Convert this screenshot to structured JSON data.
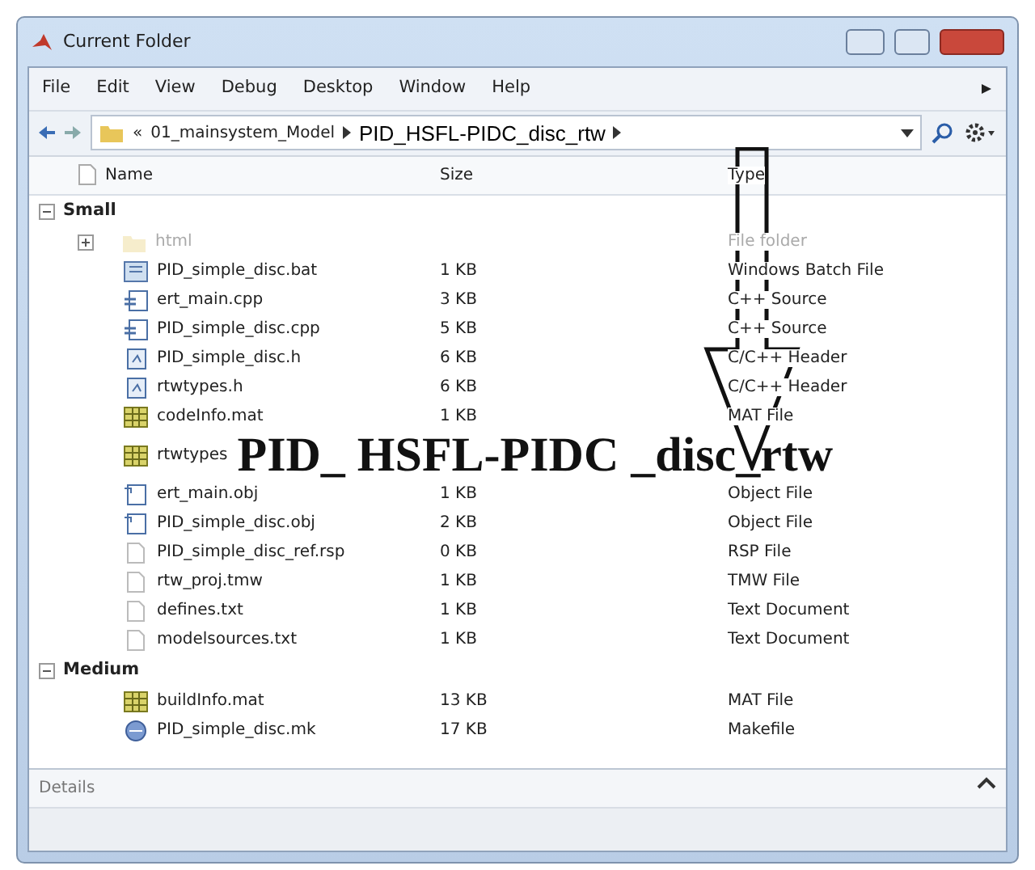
{
  "window": {
    "title": "Current Folder"
  },
  "menu": [
    "File",
    "Edit",
    "View",
    "Debug",
    "Desktop",
    "Window",
    "Help"
  ],
  "address": {
    "prefix": "«",
    "segments": [
      {
        "label": "01_mainsystem_Model",
        "kind": "folder"
      },
      {
        "label": "PID_HSFL-PIDC_disc_rtw",
        "kind": "highlight"
      }
    ]
  },
  "columns": [
    "Name",
    "Size",
    "Type"
  ],
  "groups": [
    {
      "label": "Small",
      "expanded": true,
      "files": [
        {
          "name": "html",
          "type": "File folder",
          "kind": "folder",
          "dimmed": true
        },
        {
          "name": "PID_simple_disc.bat",
          "size": "1 KB",
          "type": "Windows Batch File",
          "kind": "batch",
          "dimmed": false
        },
        {
          "name": "ert_main.cpp",
          "size": "3 KB",
          "type": "C++ Source",
          "kind": "source",
          "dimmed": false
        },
        {
          "name": "PID_simple_disc.cpp",
          "size": "5 KB",
          "type": "C++ Source",
          "kind": "source",
          "dimmed": false
        },
        {
          "name": "PID_simple_disc.h",
          "size": "6 KB",
          "type": "C/C++ Header",
          "kind": "header",
          "dimmed": false
        },
        {
          "name": "rtwtypes.h",
          "size": "6 KB",
          "type": "C/C++ Header",
          "kind": "header",
          "dimmed": false
        },
        {
          "name": "codeInfo.mat",
          "size": "1 KB",
          "type": "MAT File",
          "kind": "mat",
          "dimmed": false
        },
        {
          "name": "rtwtypes",
          "kind": "mat",
          "dimmed": false,
          "overlay": "PID_ HSFL-PIDC _disc_rtw"
        },
        {
          "name": "ert_main.obj",
          "size": "1 KB",
          "type": "Object File",
          "kind": "object",
          "dimmed": false
        },
        {
          "name": "PID_simple_disc.obj",
          "size": "2 KB",
          "type": "Object File",
          "kind": "object",
          "dimmed": false
        },
        {
          "name": "PID_simple_disc_ref.rsp",
          "size": "0 KB",
          "type": "RSP File",
          "kind": "plain",
          "dimmed": false
        },
        {
          "name": "rtw_proj.tmw",
          "size": "1 KB",
          "type": "TMW File",
          "kind": "plain",
          "dimmed": false
        },
        {
          "name": "defines.txt",
          "size": "1 KB",
          "type": "Text Document",
          "kind": "plain",
          "dimmed": false
        },
        {
          "name": "modelsources.txt",
          "size": "1 KB",
          "type": "Text Document",
          "kind": "plain",
          "dimmed": false
        }
      ]
    },
    {
      "label": "Medium",
      "expanded": true,
      "files": [
        {
          "name": "buildInfo.mat",
          "size": "13 KB",
          "type": "MAT File",
          "kind": "mat",
          "dimmed": false
        },
        {
          "name": "PID_simple_disc.mk",
          "size": "17 KB",
          "type": "Makefile",
          "kind": "makefile",
          "dimmed": false
        }
      ]
    }
  ],
  "details": {
    "label": "Details",
    "expanded": true
  }
}
